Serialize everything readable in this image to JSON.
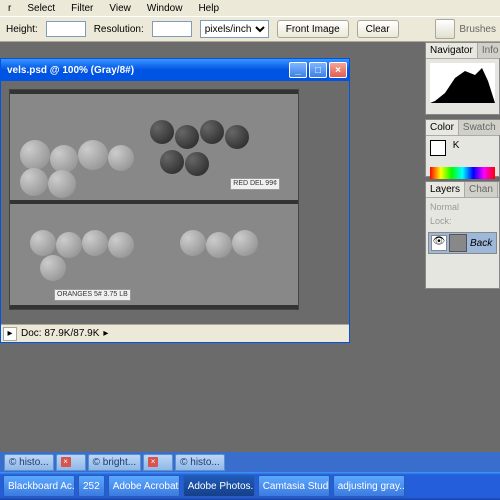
{
  "menu": {
    "items": [
      "r",
      "Select",
      "Filter",
      "View",
      "Window",
      "Help"
    ]
  },
  "options": {
    "height_lbl": "Height:",
    "res_lbl": "Resolution:",
    "units": "pixels/inch",
    "front_btn": "Front Image",
    "clear_btn": "Clear",
    "brushes_lbl": "Brushes"
  },
  "doc": {
    "title": "vels.psd @ 100% (Gray/8#)",
    "status": "Doc: 87.9K/87.9K",
    "zoom_arrow": "▸",
    "sign1": "RED DEL\n99¢",
    "sign2": "ORANGES\n5#\n3.75 LB"
  },
  "panels": {
    "nav_tab": "Navigator",
    "info_tab": "Info",
    "color_tab": "Color",
    "swatch_tab": "Swatch",
    "k_lbl": "K",
    "layers_tab": "Layers",
    "chan_tab": "Chan",
    "blend": "Normal",
    "lock_lbl": "Lock:",
    "layer_name": "Back"
  },
  "tabs": [
    {
      "label": "© histo..."
    },
    {
      "label": ""
    },
    {
      "label": "© bright..."
    },
    {
      "label": ""
    },
    {
      "label": "© histo..."
    }
  ],
  "taskbar": [
    {
      "label": "Blackboard Ac..."
    },
    {
      "label": "252"
    },
    {
      "label": "Adobe Acrobat..."
    },
    {
      "label": "Adobe Photos...",
      "active": true
    },
    {
      "label": "Camtasia Studi..."
    },
    {
      "label": "adjusting gray..."
    }
  ]
}
